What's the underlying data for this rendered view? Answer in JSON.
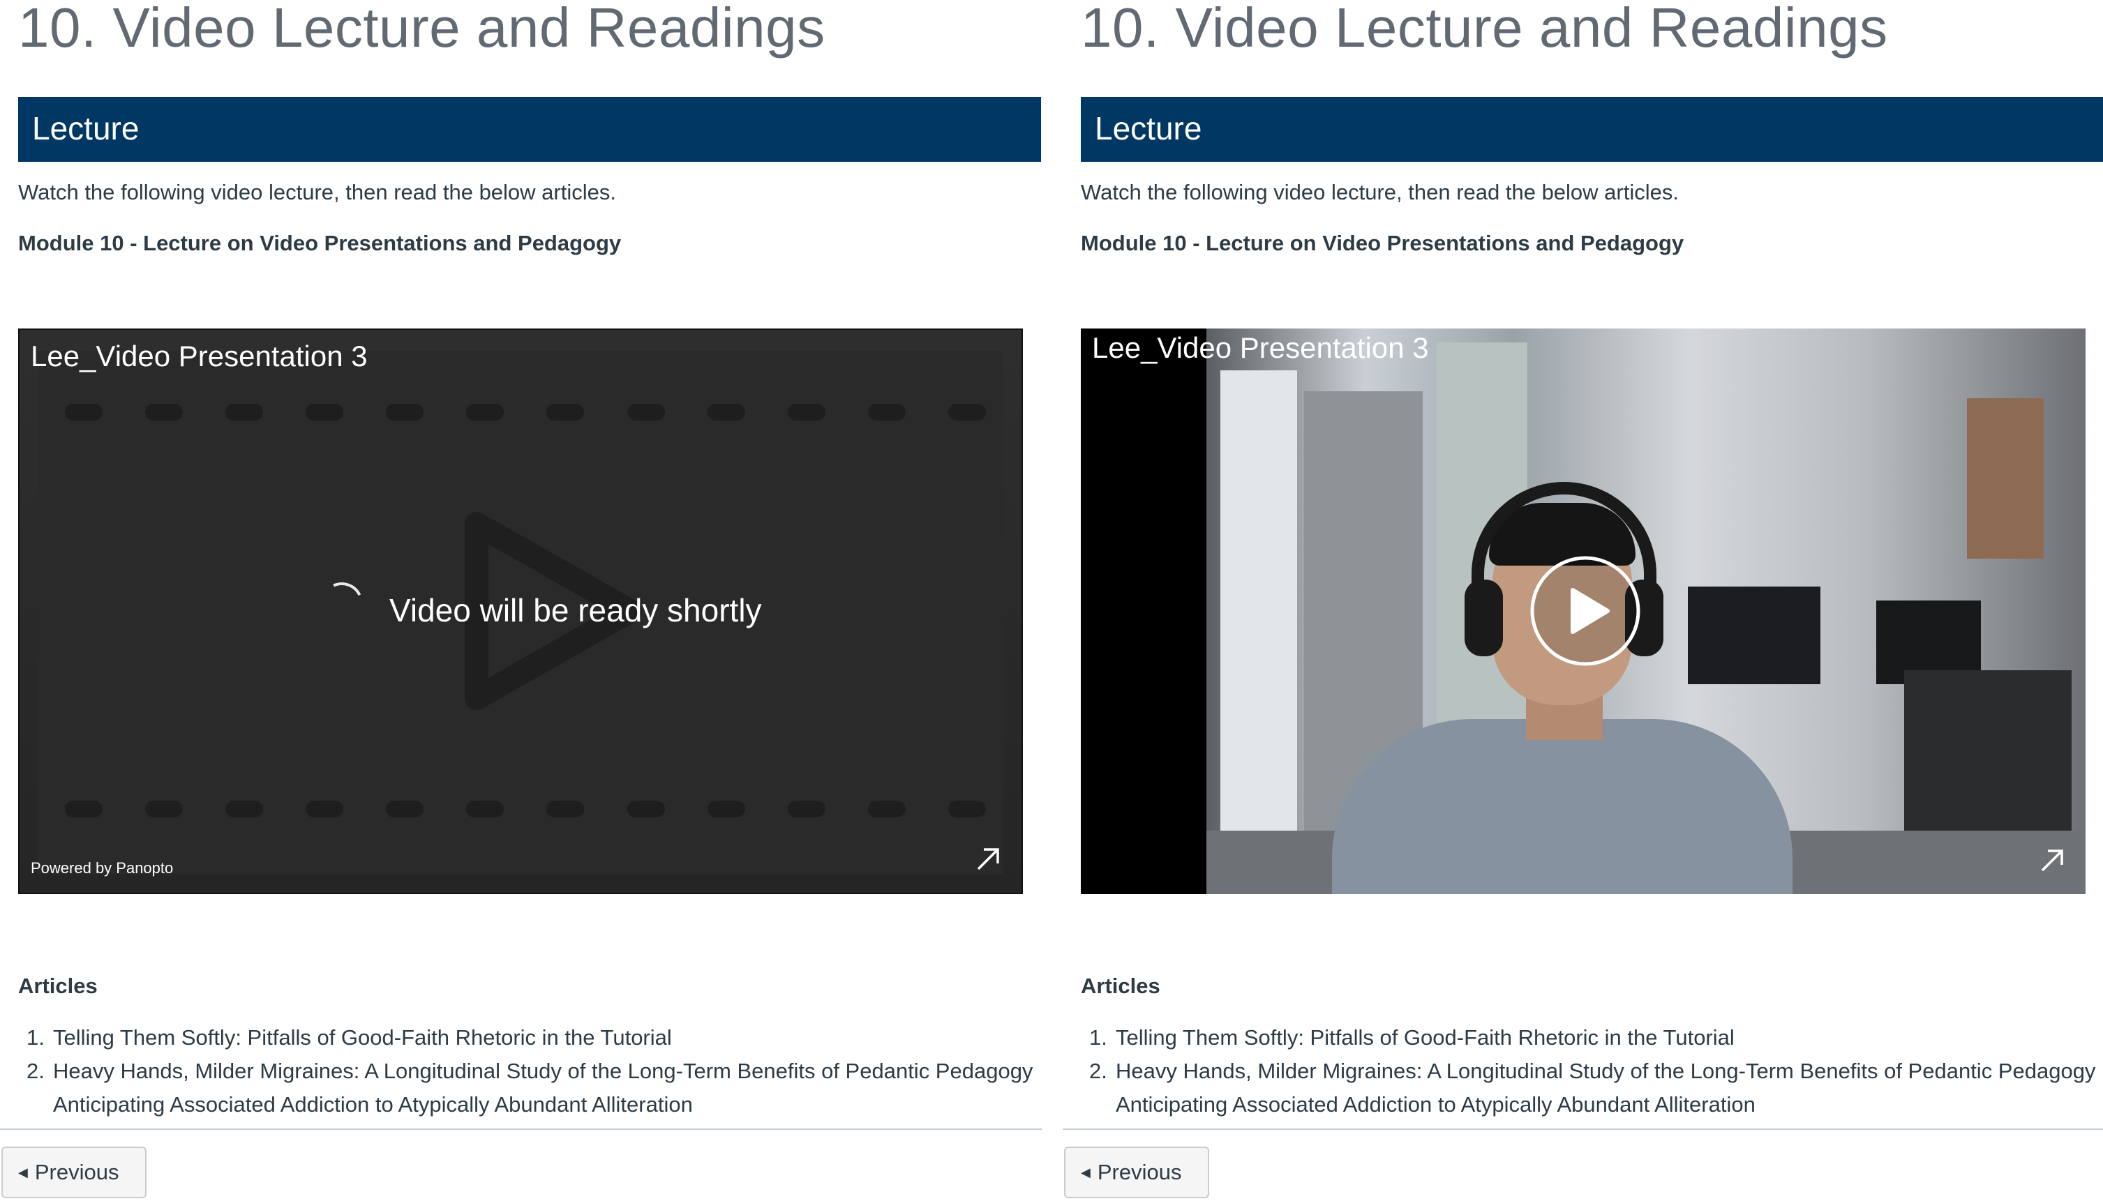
{
  "page": {
    "title": "10. Video Lecture and Readings",
    "section_title": "Lecture",
    "intro": "Watch the following video lecture, then read the below articles.",
    "module_title": "Module 10 - Lecture on Video Presentations and Pedagogy",
    "articles_heading": "Articles",
    "articles": [
      {
        "num": "1.",
        "line1": "Telling Them Softly: Pitfalls of Good-Faith Rhetoric in the Tutorial",
        "line2": ""
      },
      {
        "num": "2.",
        "line1": "Heavy Hands, Milder Migraines: A Longitudinal Study of the Long-Term Benefits of Pedantic Pedagogy",
        "line2": "Anticipating Associated Addiction to Atypically Abundant Alliteration"
      }
    ],
    "previous_label": "Previous"
  },
  "video_left": {
    "title": "Lee_Video Presentation 3",
    "status": "Video will be ready shortly",
    "powered_by": "Powered by Panopto"
  },
  "video_right": {
    "title": "Lee_Video Presentation 3"
  },
  "colors": {
    "section_bar": "#003863",
    "title_gray": "#616a72",
    "body_text": "#2d3b45"
  },
  "icons": {
    "spinner": "loading-spinner-icon",
    "expand": "expand-arrow-icon",
    "play": "play-icon",
    "caret": "caret-left-icon"
  }
}
